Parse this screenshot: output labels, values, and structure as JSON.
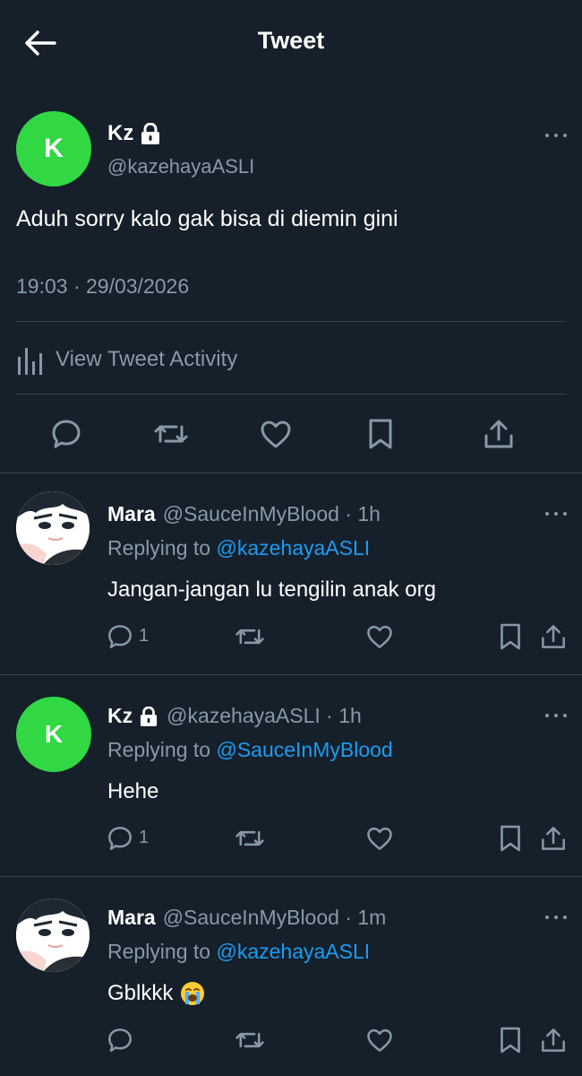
{
  "header": {
    "title": "Tweet",
    "back_icon": "arrow-left-icon"
  },
  "main_tweet": {
    "avatar_letter": "K",
    "name": "Kz",
    "handle": "@kazehayaASLI",
    "text": "Aduh sorry kalo gak bisa di diemin gini",
    "timestamp": "19:03 · 29/03/2026",
    "activity_label": "View Tweet Activity",
    "actions": [
      "reply-icon",
      "retweet-icon",
      "like-icon",
      "bookmark-icon",
      "share-icon"
    ]
  },
  "replies": [
    {
      "name": "Mara",
      "meta": "@SauceInMyBlood · 1h",
      "replying_prefix": "Replying to ",
      "replying_to": "@kazehayaASLI",
      "text": "Jangan-jangan lu tengilin anak org",
      "reply_count": "1"
    },
    {
      "name": "Kz",
      "meta": "@kazehayaASLI · 1h",
      "avatar_letter": "K",
      "replying_prefix": "Replying to ",
      "replying_to": "@SauceInMyBlood",
      "text": "Hehe",
      "reply_count": "1"
    },
    {
      "name": "Mara",
      "meta": "@SauceInMyBlood · 1m",
      "replying_prefix": "Replying to ",
      "replying_to": "@kazehayaASLI",
      "text": "Gblkkk",
      "emoji": "loudly-crying-face"
    }
  ],
  "colors": {
    "background": "#15202b",
    "secondary_text": "#8899a6",
    "mention": "#1d9bf0",
    "avatar_green": "#31d843",
    "divider": "#38444d"
  }
}
